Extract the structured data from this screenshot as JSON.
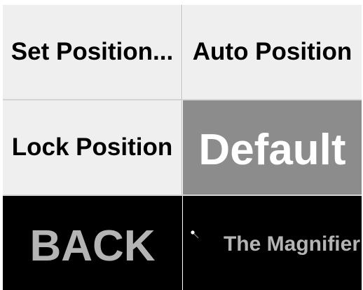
{
  "tiles": {
    "set_position": "Set Position...",
    "auto_position": "Auto Position",
    "lock_position": "Lock Position",
    "default": "Default",
    "back": "BACK",
    "magnifier": "The Magnifier"
  },
  "icons": {
    "magnifier": "magnifier-pointer-icon"
  },
  "colors": {
    "light_tile": "#efefef",
    "default_tile": "#8c8c8c",
    "dark_tile": "#000000",
    "dark_text": "#b4b4b4"
  }
}
